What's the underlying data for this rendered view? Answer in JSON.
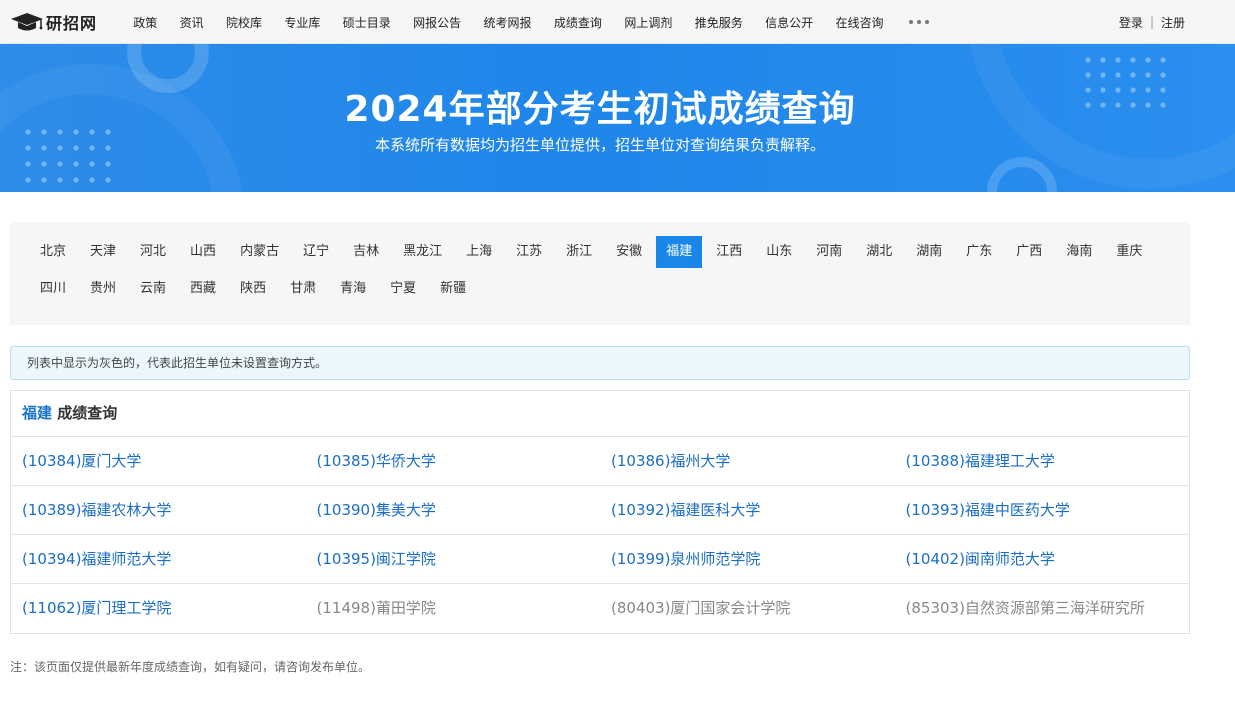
{
  "brand": {
    "name": "研招网",
    "logo_icon": "graduation-cap-icon"
  },
  "nav": {
    "items": [
      "政策",
      "资讯",
      "院校库",
      "专业库",
      "硕士目录",
      "网报公告",
      "统考网报",
      "成绩查询",
      "网上调剂",
      "推免服务",
      "信息公开",
      "在线咨询"
    ],
    "more_icon": "more-dots-icon"
  },
  "user": {
    "login": "登录",
    "separator": "|",
    "register": "注册"
  },
  "banner": {
    "title": "2024年部分考生初试成绩查询",
    "subtitle": "本系统所有数据均为招生单位提供，招生单位对查询结果负责解释。"
  },
  "provinces": {
    "items": [
      "北京",
      "天津",
      "河北",
      "山西",
      "内蒙古",
      "辽宁",
      "吉林",
      "黑龙江",
      "上海",
      "江苏",
      "浙江",
      "安徽",
      "福建",
      "江西",
      "山东",
      "河南",
      "湖北",
      "湖南",
      "广东",
      "广西",
      "海南",
      "重庆",
      "四川",
      "贵州",
      "云南",
      "西藏",
      "陕西",
      "甘肃",
      "青海",
      "宁夏",
      "新疆"
    ],
    "selected": "福建",
    "active_color": "#1a86e8"
  },
  "notice": "列表中显示为灰色的，代表此招生单位未设置查询方式。",
  "result": {
    "province": "福建",
    "heading_suffix": " 成绩查询",
    "rows": [
      [
        {
          "label": "(10384)厦门大学",
          "enabled": true
        },
        {
          "label": "(10385)华侨大学",
          "enabled": true
        },
        {
          "label": "(10386)福州大学",
          "enabled": true
        },
        {
          "label": "(10388)福建理工大学",
          "enabled": true
        }
      ],
      [
        {
          "label": "(10389)福建农林大学",
          "enabled": true
        },
        {
          "label": "(10390)集美大学",
          "enabled": true
        },
        {
          "label": "(10392)福建医科大学",
          "enabled": true
        },
        {
          "label": "(10393)福建中医药大学",
          "enabled": true
        }
      ],
      [
        {
          "label": "(10394)福建师范大学",
          "enabled": true
        },
        {
          "label": "(10395)闽江学院",
          "enabled": true
        },
        {
          "label": "(10399)泉州师范学院",
          "enabled": true
        },
        {
          "label": "(10402)闽南师范大学",
          "enabled": true
        }
      ],
      [
        {
          "label": "(11062)厦门理工学院",
          "enabled": true
        },
        {
          "label": "(11498)莆田学院",
          "enabled": false
        },
        {
          "label": "(80403)厦门国家会计学院",
          "enabled": false
        },
        {
          "label": "(85303)自然资源部第三海洋研究所",
          "enabled": false
        }
      ]
    ],
    "link_color": "#1a6ec4",
    "disabled_color": "#888888"
  },
  "footer_note": "注：该页面仅提供最新年度成绩查询，如有疑问，请咨询发布单位。"
}
